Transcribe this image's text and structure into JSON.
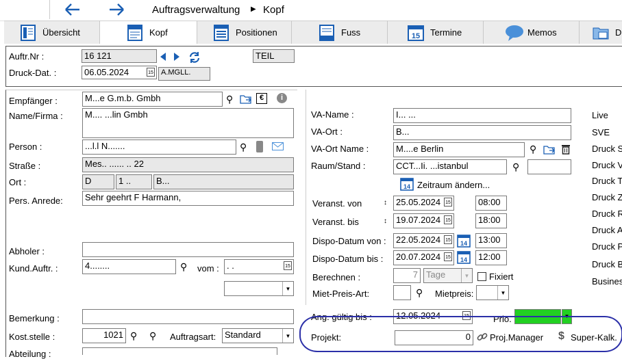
{
  "nav": {
    "back_icon": "arrow-left",
    "forward_icon": "arrow-right",
    "path_root": "Auftragsverwaltung",
    "separator": "▶",
    "path_current": "Kopf"
  },
  "tabs": [
    {
      "label": "Übersicht",
      "icon": "overview-icon"
    },
    {
      "label": "Kopf",
      "icon": "document-icon"
    },
    {
      "label": "Positionen",
      "icon": "list-icon"
    },
    {
      "label": "Fuss",
      "icon": "footer-icon"
    },
    {
      "label": "Termine",
      "icon": "calendar-icon",
      "icon_text": "15"
    },
    {
      "label": "Memos",
      "icon": "chat-icon"
    },
    {
      "label": "D",
      "icon": "folder-icon"
    }
  ],
  "header": {
    "auftr_nr_label": "Auftr.Nr :",
    "auftr_nr_value": "16  121",
    "teil_label": "TEIL",
    "druck_dat_label": "Druck-Dat. :",
    "druck_dat_value": "06.05.2024",
    "status_value": "A.MGLL."
  },
  "customer": {
    "empfaenger_label": "Empfänger :",
    "empfaenger_value": "M...e G.m.b. Gmbh",
    "name_label": "Name/Firma :",
    "name_value": "M....  ...lin Gmbh",
    "person_label": "Person :",
    "person_value": "...l.l N.......",
    "strasse_label": "Straße :",
    "strasse_value": "Mes.. ......  .. 22",
    "ort_label": "Ort :",
    "ort_country": "D",
    "ort_zip": "1  ..",
    "ort_city": "B...",
    "anrede_label": "Pers. Anrede:",
    "anrede_value": "Sehr geehrt  F     Harmann,",
    "abholer_label": "Abholer :",
    "abholer_value": "",
    "kundauftr_label": "Kund.Auftr. :",
    "kundauftr_value": "4........",
    "vom_label": "vom :",
    "vom_value": ". .",
    "bemerkung_label": "Bemerkung :",
    "bemerkung_value": "",
    "koststelle_label": "Kost.stelle :",
    "koststelle_value": "1021",
    "auftragsart_label": "Auftragsart:",
    "auftragsart_value": "Standard",
    "abteilung_label": "Abteilung :",
    "abteilung_value": ""
  },
  "event": {
    "va_name_label": "VA-Name :",
    "va_name_value": "I...  ...",
    "va_ort_label": "VA-Ort :",
    "va_ort_value": "B...",
    "va_ort_name_label": "VA-Ort Name :",
    "va_ort_name_value": "M....e Berlin",
    "raum_label": "Raum/Stand :",
    "raum_value": "CCT...Ii. ...istanbul",
    "raum_extra": "",
    "zeitraum_label": "Zeitraum ändern...",
    "zeitraum_icon_text": "14",
    "von_label": "Veranst. von",
    "von_prefix": "↕",
    "von_date": "25.05.2024",
    "von_time": "08:00",
    "bis_label": "Veranst. bis",
    "bis_prefix": "↕",
    "bis_date": "19.07.2024",
    "bis_time": "18:00",
    "dispo_von_label": "Dispo-Datum von :",
    "dispo_von_date": "22.05.2024",
    "dispo_von_time": "13:00",
    "dispo_bis_label": "Dispo-Datum bis :",
    "dispo_bis_date": "20.07.2024",
    "dispo_bis_time": "12:00",
    "berechnen_label": "Berechnen :",
    "berechnen_value": "7",
    "berechnen_unit": "Tage",
    "fixiert_label": "Fixiert",
    "mietpreisart_label": "Miet-Preis-Art:",
    "mietpreisart_value": "",
    "mietpreis_label": "Mietpreis:",
    "mietpreis_value": "",
    "ang_label": "Ang. gültig bis :",
    "ang_value": "12.05.2024",
    "prio_label": "Prio.",
    "projekt_label": "Projekt:",
    "projekt_value": "0",
    "proj_manager_label": "Proj.Manager",
    "super_kalk_label": "Super-Kalk."
  },
  "right_list": [
    "Live",
    "SVE",
    "Druck S",
    "Druck V",
    "Druck T",
    "Druck Z",
    "Druck R",
    "Druck A",
    "Druck P",
    "Druck B",
    "Busines"
  ],
  "colors": {
    "prio_green": "#22d022",
    "highlight_oval": "#2b2fa8",
    "tab_bg": "#ececec",
    "readonly_bg": "#e8e8e8",
    "nav_blue": "#1a5fb4"
  }
}
